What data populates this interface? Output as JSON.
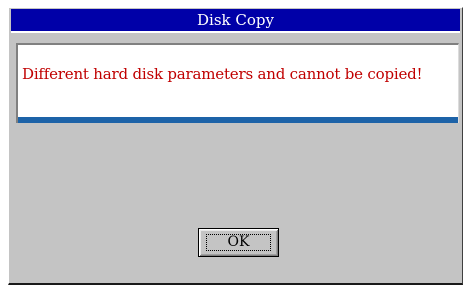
{
  "dialog": {
    "title": "Disk Copy",
    "message": "Different hard disk parameters and cannot be copied!",
    "ok_label": "OK"
  },
  "colors": {
    "titlebar": "#0000a8",
    "message_text": "#c00000",
    "dialog_background": "#c4c4c4",
    "accent_bar": "#1d63a8"
  }
}
